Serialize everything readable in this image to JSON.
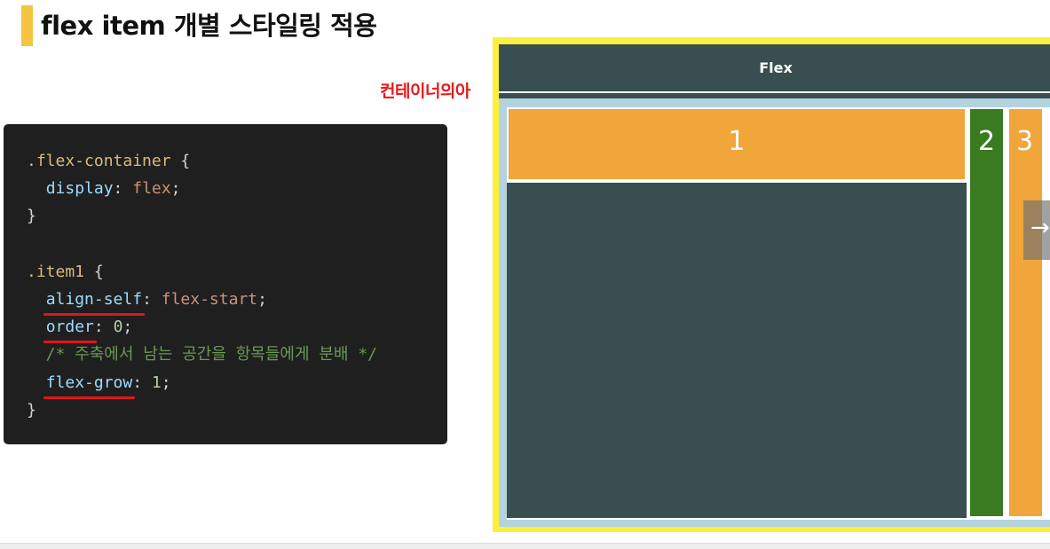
{
  "slide": {
    "title": "flex item 개별 스타일링 적용",
    "accent_color": "#f6c443"
  },
  "code": {
    "lines": [
      [
        {
          "t": ".flex-container",
          "c": "sel"
        },
        {
          "t": " {",
          "c": "punc"
        }
      ],
      [
        {
          "t": "  ",
          "c": "punc"
        },
        {
          "t": "display",
          "c": "prop"
        },
        {
          "t": ": ",
          "c": "punc"
        },
        {
          "t": "flex",
          "c": "val"
        },
        {
          "t": ";",
          "c": "punc"
        }
      ],
      [
        {
          "t": "}",
          "c": "punc"
        }
      ],
      [
        {
          "t": "",
          "c": "punc"
        }
      ],
      [
        {
          "t": ".item1",
          "c": "sel"
        },
        {
          "t": " {",
          "c": "punc"
        }
      ],
      [
        {
          "t": "  ",
          "c": "punc"
        },
        {
          "t": "align-self",
          "c": "prop",
          "u": true
        },
        {
          "t": ": ",
          "c": "punc"
        },
        {
          "t": "flex-start",
          "c": "val"
        },
        {
          "t": ";",
          "c": "punc"
        }
      ],
      [
        {
          "t": "  ",
          "c": "punc"
        },
        {
          "t": "order",
          "c": "prop",
          "u": true
        },
        {
          "t": ": ",
          "c": "punc"
        },
        {
          "t": "0",
          "c": "num"
        },
        {
          "t": ";",
          "c": "punc"
        }
      ],
      [
        {
          "t": "  /* 주축에서 남는 공간을 항목들에게 분배 */",
          "c": "cmt"
        }
      ],
      [
        {
          "t": "  ",
          "c": "punc"
        },
        {
          "t": "flex-grow",
          "c": "prop",
          "u": true
        },
        {
          "t": ": ",
          "c": "punc"
        },
        {
          "t": "1",
          "c": "num"
        },
        {
          "t": ";",
          "c": "punc"
        }
      ],
      [
        {
          "t": "}",
          "c": "punc"
        }
      ]
    ],
    "underline_color": "#e0141b"
  },
  "annotation": {
    "container_label": "컨테이너의아"
  },
  "demo": {
    "header_title": "Flex",
    "items": [
      {
        "label": "1",
        "color": "#f0a63a"
      },
      {
        "label": "2",
        "color": "#3a7b22"
      },
      {
        "label": "3",
        "color": "#f0a63a"
      }
    ],
    "container_color": "#384e50",
    "frame_color": "#fbf03c",
    "next_icon": "arrow-right-icon"
  }
}
